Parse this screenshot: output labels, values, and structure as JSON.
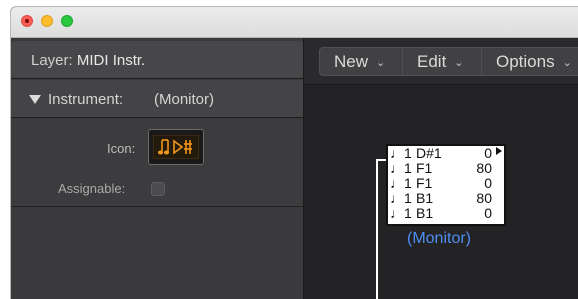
{
  "inspector": {
    "layer_label": "Layer:",
    "layer_value": "MIDI Instr.",
    "instrument_label": "Instrument:",
    "instrument_value": "(Monitor)",
    "icon_label": "Icon:",
    "assignable_label": "Assignable:",
    "assignable_checked": false
  },
  "toolbar": {
    "new_label": "New",
    "edit_label": "Edit",
    "options_label": "Options"
  },
  "monitor": {
    "rows": [
      {
        "num": "1",
        "name": "D#1",
        "value": "0"
      },
      {
        "num": "1",
        "name": "F1",
        "value": "80"
      },
      {
        "num": "1",
        "name": "F1",
        "value": "0"
      },
      {
        "num": "1",
        "name": "B1",
        "value": "80"
      },
      {
        "num": "1",
        "name": "B1",
        "value": "0"
      }
    ],
    "caption": "(Monitor)"
  },
  "colors": {
    "accent_blue": "#4d8ef0",
    "icon_orange": "#f0961e"
  }
}
